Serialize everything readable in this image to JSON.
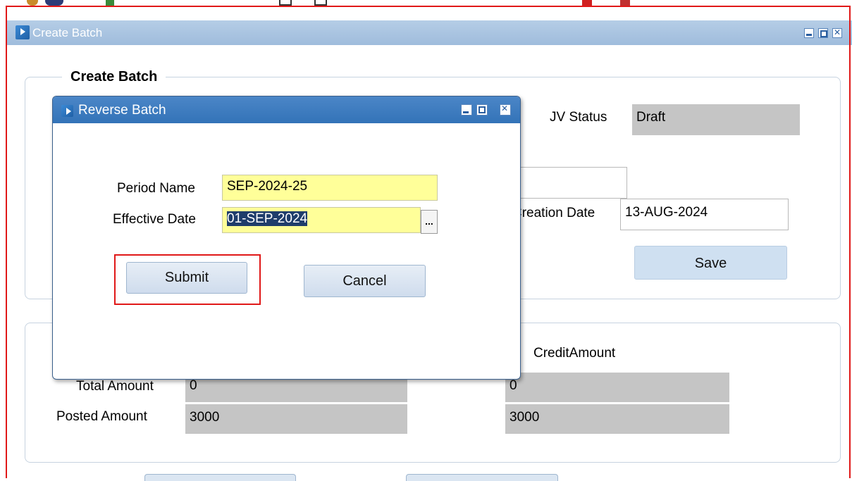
{
  "main_window": {
    "title": "Create Batch"
  },
  "form": {
    "group_title": "Create Batch",
    "jv_status_label": "JV Status",
    "jv_status_value": "Draft",
    "creation_date_label": "Creation Date",
    "creation_date_value": "13-AUG-2024",
    "save_label": "Save"
  },
  "amounts": {
    "credit_header": "CreditAmount",
    "total_label": "Total Amount",
    "total_debit": "0",
    "total_credit": "0",
    "posted_label": "Posted Amount",
    "posted_debit": "3000",
    "posted_credit": "3000"
  },
  "dialog": {
    "title": "Reverse Batch",
    "period_name_label": "Period Name",
    "period_name_value": "SEP-2024-25",
    "effective_date_label": "Effective Date",
    "effective_date_value": "01-SEP-2024",
    "lov_button": "...",
    "submit_label": "Submit",
    "cancel_label": "Cancel"
  },
  "colors": {
    "highlight": "#e01818",
    "dialog_titlebar": "#3373b8",
    "required_field": "#ffff99",
    "readonly_field": "#c5c5c5"
  }
}
